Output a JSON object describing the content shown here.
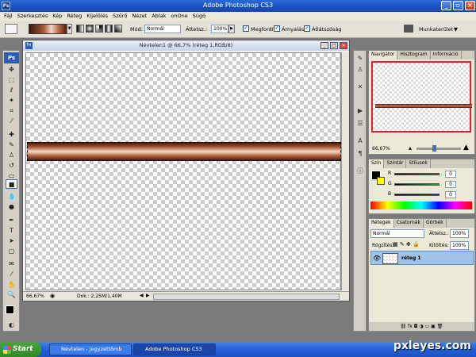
{
  "app": {
    "title": "Adobe Photoshop CS3"
  },
  "menu": [
    "Fájl",
    "Szerkesztés",
    "Kép",
    "Réteg",
    "Kijelölés",
    "Szűrő",
    "Nézet",
    "Ablak",
    "onOne",
    "Súgó"
  ],
  "options": {
    "mode_label": "Mód:",
    "mode_value": "Normál",
    "opacity_label": "Áttetsz.:",
    "opacity_value": "100%",
    "reverse_label": "Megfordít",
    "dither_label": "Árnyalás",
    "transparency_label": "Átlátszóság",
    "workspace_label": "Munkaterület"
  },
  "document": {
    "title": "Névtelen1 @ 66,7% (réteg 1,RGB/8)",
    "zoom": "66,67%",
    "doc_size": "Dok.: 2,25M/1,40M"
  },
  "navigator": {
    "tabs": [
      "Navigátor",
      "Hisztogram",
      "Információ"
    ],
    "zoom": "66,67%"
  },
  "color": {
    "tabs": [
      "Szín",
      "Színtár",
      "Stílusok"
    ],
    "channels": [
      {
        "label": "R",
        "value": "0",
        "color": "#c22"
      },
      {
        "label": "G",
        "value": "0",
        "color": "#2a2"
      },
      {
        "label": "B",
        "value": "0",
        "color": "#22c"
      }
    ]
  },
  "layers": {
    "tabs": [
      "Rétegek",
      "Csatornák",
      "Görbék"
    ],
    "blend_mode": "Normál",
    "opacity_label": "Áttetsz.:",
    "opacity_value": "100%",
    "lock_label": "Rögzítés:",
    "fill_label": "Kitöltés:",
    "fill_value": "100%",
    "layer_name": "réteg 1"
  },
  "taskbar": {
    "start_label": "Start",
    "tasks": [
      "Névtelen - Jegyzettömb",
      "Adobe Photoshop CS3"
    ]
  },
  "watermark": "pxleyes.com"
}
